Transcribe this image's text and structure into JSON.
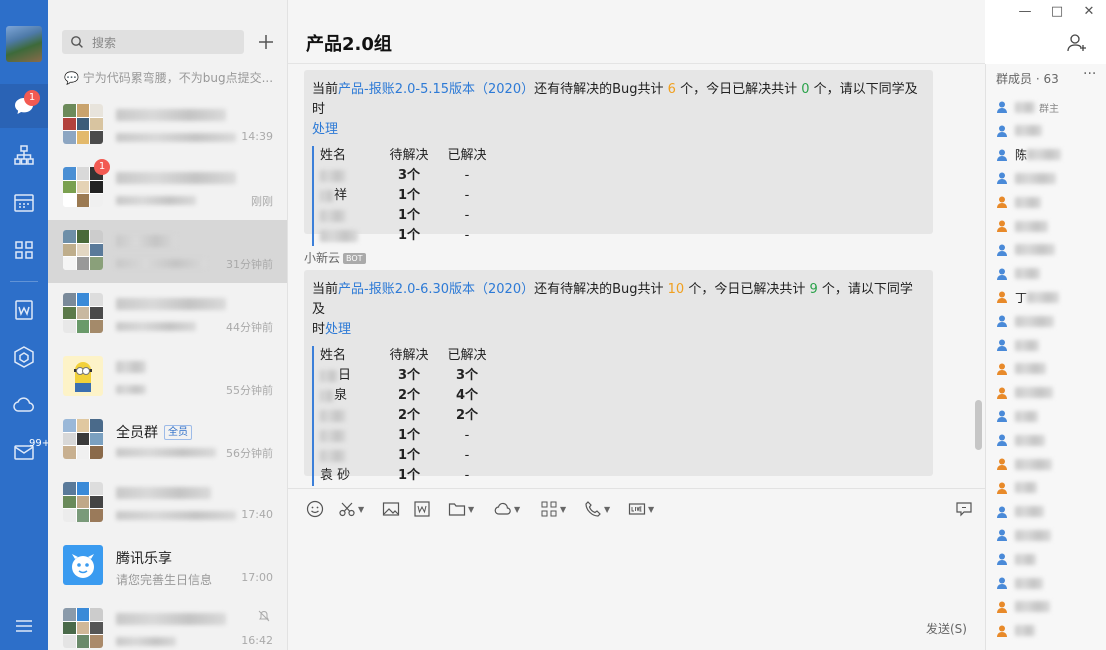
{
  "search": {
    "placeholder": "搜索"
  },
  "draft": "宁为代码累弯腰，不为bug点提交...",
  "nav": {
    "msg_badge": "1",
    "mail_badge": "99+"
  },
  "conversations": [
    {
      "name": "",
      "sub": "",
      "time": "14:39"
    },
    {
      "name": "",
      "sub": "",
      "time": "刚刚",
      "badge": "1"
    },
    {
      "name": "",
      "sub": "",
      "time": "31分钟前"
    },
    {
      "name": "",
      "sub": "",
      "time": "44分钟前"
    },
    {
      "name": "",
      "sub": "",
      "time": "55分钟前"
    },
    {
      "name": "全员群",
      "tag": "全员",
      "sub": "",
      "time": "56分钟前"
    },
    {
      "name": "",
      "sub": "",
      "time": "17:40"
    },
    {
      "name": "腾讯乐享",
      "sub": "请您完善生日信息",
      "time": "17:00"
    },
    {
      "name": "",
      "sub": "",
      "time": "16:42"
    }
  ],
  "chat": {
    "title": "产品2.0组",
    "msg1": {
      "prefix": "当前",
      "link": "产品-报账2.0-5.15版本（2020）",
      "mid1": "还有待解决的Bug共计 ",
      "pending": "6",
      "mid2": " 个，今日已解决共计 ",
      "solved": "0",
      "mid3": " 个，请以下同学及时",
      "action": "处理",
      "headers": [
        "姓名",
        "待解决",
        "已解决"
      ],
      "rows": [
        [
          "",
          "3个",
          "-"
        ],
        [
          "祥",
          "1个",
          "-"
        ],
        [
          "",
          "1个",
          "-"
        ],
        [
          "",
          "1个",
          "-"
        ]
      ]
    },
    "sender2": "小新云",
    "sender2_tag": "BOT",
    "msg2": {
      "prefix": "当前",
      "link": "产品-报账2.0-6.30版本（2020）",
      "mid1": "还有待解决的Bug共计 ",
      "pending": "10",
      "mid2": " 个，今日已解决共计 ",
      "solved": "9",
      "mid3": " 个，请以下同学及",
      "tail": "时",
      "action": "处理",
      "headers": [
        "姓名",
        "待解决",
        "已解决"
      ],
      "rows": [
        [
          "日",
          "3个",
          "3个"
        ],
        [
          "泉",
          "2个",
          "4个"
        ],
        [
          "",
          "2个",
          "2个"
        ],
        [
          "",
          "1个",
          "-"
        ],
        [
          "",
          "1个",
          "-"
        ],
        [
          "袁 砂",
          "1个",
          "-"
        ]
      ]
    },
    "send_label": "发送(S)"
  },
  "members": {
    "header": "群成员 · 63",
    "owner_tag": "群主",
    "visible_chars": [
      "",
      "",
      "陈",
      "",
      "",
      "",
      "",
      "",
      "丁",
      "",
      "",
      "",
      "",
      "",
      "",
      "",
      "",
      "",
      "",
      "",
      "",
      "",
      ""
    ]
  },
  "colors": {
    "nav": "#2d6fc9",
    "link": "#2d7ad6",
    "orange": "#f0a020",
    "green": "#2aa24a",
    "badge": "#f25a52"
  }
}
